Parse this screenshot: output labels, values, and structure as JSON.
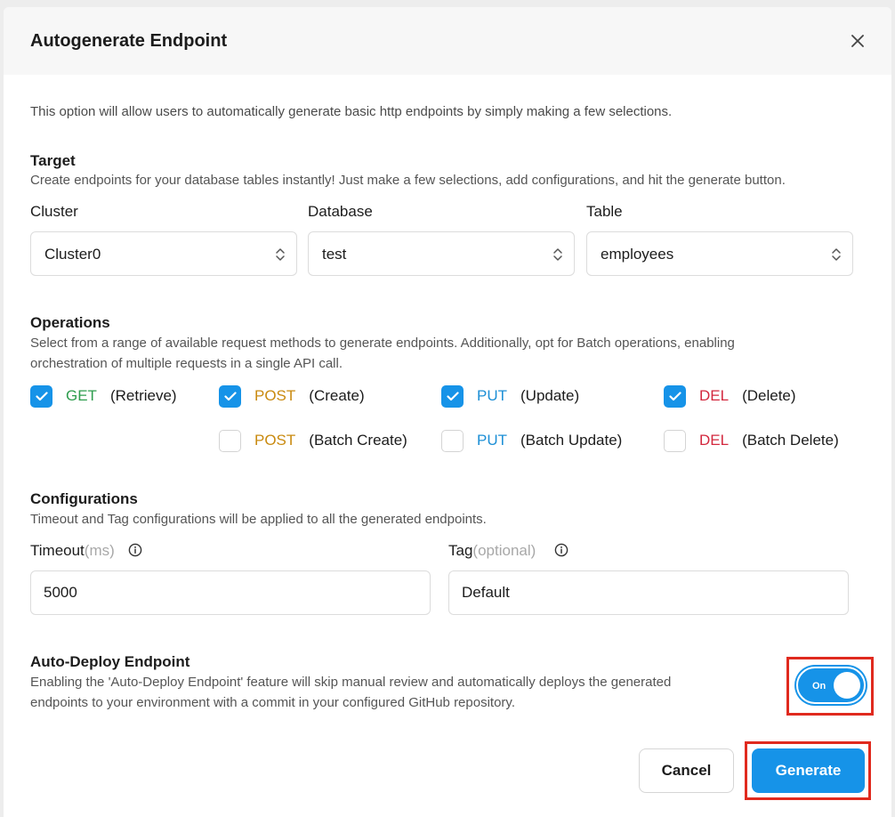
{
  "modal": {
    "title": "Autogenerate Endpoint",
    "intro": "This option will allow users to automatically generate basic http endpoints by simply making a few selections."
  },
  "target": {
    "title": "Target",
    "description": "Create endpoints for your database tables instantly! Just make a few selections, add configurations, and hit the generate button.",
    "fields": [
      {
        "label": "Cluster",
        "value": "Cluster0"
      },
      {
        "label": "Database",
        "value": "test"
      },
      {
        "label": "Table",
        "value": "employees"
      }
    ]
  },
  "operations": {
    "title": "Operations",
    "description_line1": "Select from a range of available request methods to generate endpoints. Additionally, opt for Batch operations, enabling",
    "description_line2": "orchestration of multiple requests in a single API call.",
    "items": [
      {
        "method": "GET",
        "label": "(Retrieve)",
        "checked": true
      },
      {
        "method": "POST",
        "label": "(Create)",
        "checked": true
      },
      {
        "method": "PUT",
        "label": "(Update)",
        "checked": true
      },
      {
        "method": "DEL",
        "label": "(Delete)",
        "checked": true
      },
      {
        "method": "POST",
        "label": "(Batch Create)",
        "checked": false
      },
      {
        "method": "PUT",
        "label": "(Batch Update)",
        "checked": false
      },
      {
        "method": "DEL",
        "label": "(Batch Delete)",
        "checked": false
      }
    ]
  },
  "configurations": {
    "title": "Configurations",
    "description": "Timeout and Tag configurations will be applied to all the generated endpoints.",
    "timeout": {
      "label": "Timeout",
      "hint": "(ms)",
      "value": "5000"
    },
    "tag": {
      "label": "Tag",
      "hint": "(optional)",
      "value": "Default"
    }
  },
  "auto_deploy": {
    "title": "Auto-Deploy Endpoint",
    "description_line1": "Enabling the 'Auto-Deploy Endpoint' feature will skip manual review and automatically deploys the generated",
    "description_line2": "endpoints to your environment with a commit in your configured GitHub repository.",
    "toggle_label": "On",
    "enabled": true
  },
  "footer": {
    "cancel_label": "Cancel",
    "generate_label": "Generate"
  },
  "colors": {
    "accent": "#1693e8",
    "get": "#2e9d4e",
    "post": "#c98a10",
    "put": "#1d8fd6",
    "del": "#d3283e",
    "highlight": "#e02a1e"
  },
  "icons": {
    "close": "close-icon",
    "select_chevron": "chevron-up-down-icon",
    "checkbox_checked": "check-icon",
    "info": "info-icon"
  }
}
